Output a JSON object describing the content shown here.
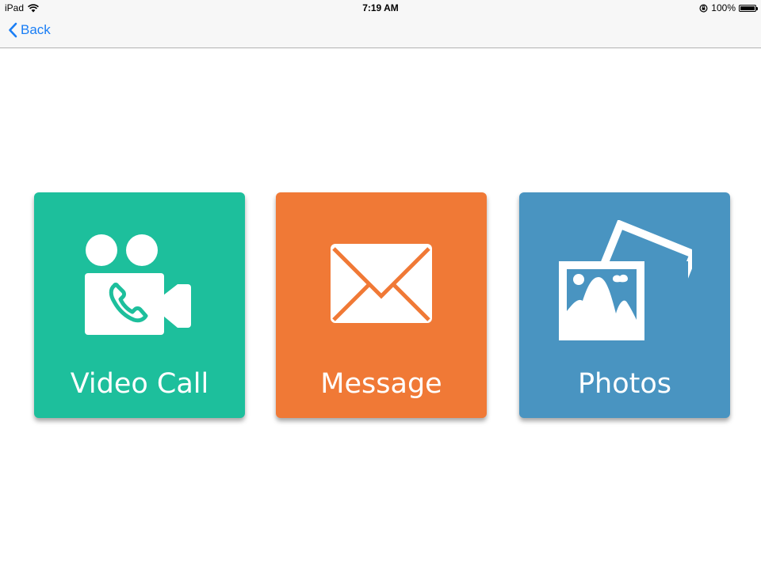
{
  "status_bar": {
    "device": "iPad",
    "time": "7:19 AM",
    "battery": "100%",
    "icons": [
      "wifi-icon",
      "orientation-lock-icon",
      "battery-icon"
    ]
  },
  "nav": {
    "back_label": "Back",
    "back_icon": "chevron-left-icon",
    "accent_color": "#1a7ef5"
  },
  "tiles": [
    {
      "label": "Video Call",
      "icon": "video-call-icon",
      "color": "#1dbf9c"
    },
    {
      "label": "Message",
      "icon": "envelope-icon",
      "color": "#f07936"
    },
    {
      "label": "Photos",
      "icon": "photos-icon",
      "color": "#4994c1"
    }
  ]
}
